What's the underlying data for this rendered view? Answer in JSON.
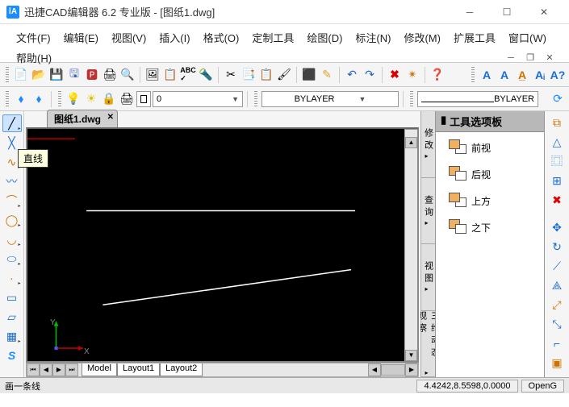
{
  "window": {
    "app_icon": "ⅠA",
    "title": "迅捷CAD编辑器 6.2 专业版  -  [图纸1.dwg]"
  },
  "menu": [
    "文件(F)",
    "编辑(E)",
    "视图(V)",
    "插入(I)",
    "格式(O)",
    "定制工具",
    "绘图(D)",
    "标注(N)",
    "修改(M)",
    "扩展工具",
    "窗口(W)",
    "帮助(H)"
  ],
  "toolbar2": {
    "bylayer1": "BYLAYER",
    "bylayer2": "BYLAYER"
  },
  "doc_tab": "图纸1.dwg",
  "tooltip": "直线",
  "axes": {
    "x": "X",
    "y": "Y"
  },
  "layout_tabs": [
    "Model",
    "Layout1",
    "Layout2"
  ],
  "vtabs": [
    "修改",
    "查询",
    "视图",
    "三维动态观察"
  ],
  "palette": {
    "title": "工具选项板",
    "items": [
      "前视",
      "后视",
      "上方",
      "之下"
    ]
  },
  "status": {
    "hint": "画一条线",
    "coords": "4.4242,8.5598,0.0000",
    "render": "OpenG"
  }
}
